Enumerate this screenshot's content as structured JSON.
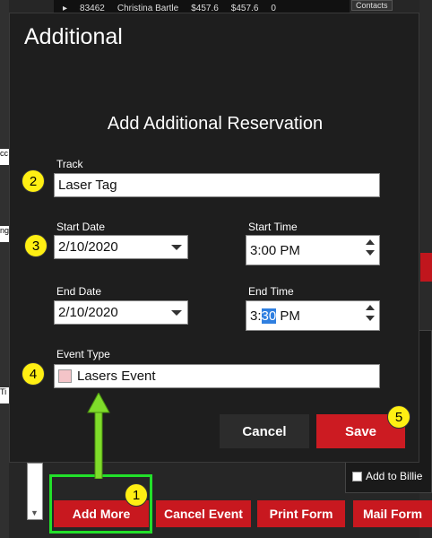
{
  "background": {
    "row": {
      "expander": "▸",
      "id": "83462",
      "name": "Christina Bartle",
      "amount1": "$457.6",
      "amount2": "$457.6",
      "count": "0"
    },
    "tab_right": "Contacts",
    "left_marks": [
      "cc",
      "ng",
      "Ti"
    ],
    "panel_checkbox_label": "Add to Billie",
    "bottom_buttons": {
      "add_more": "Add More",
      "cancel_event": "Cancel Event",
      "print_form": "Print Form",
      "mail_form": "Mail Form"
    }
  },
  "modal": {
    "title": "Additional",
    "heading": "Add Additional Reservation",
    "track": {
      "label": "Track",
      "value": "Laser Tag"
    },
    "start_date": {
      "label": "Start Date",
      "value": "2/10/2020"
    },
    "start_time": {
      "label": "Start Time",
      "value": "3:00 PM"
    },
    "end_date": {
      "label": "End Date",
      "value": "2/10/2020"
    },
    "end_time": {
      "label": "End Time",
      "hour": "3:",
      "minute_selected": "30",
      "suffix": " PM"
    },
    "event_type": {
      "label": "Event Type",
      "value": "Lasers Event",
      "swatch_color": "#f4c4c8"
    },
    "cancel_label": "Cancel",
    "save_label": "Save"
  },
  "annotations": {
    "badge1": "1",
    "badge2": "2",
    "badge3": "3",
    "badge4": "4",
    "badge5": "5",
    "highlight_color": "#22e02a",
    "badge_color": "#ffef13"
  },
  "colors": {
    "accent_red": "#cc1b22",
    "modal_bg": "#1e1e1e",
    "selection_blue": "#2f7fe0"
  }
}
